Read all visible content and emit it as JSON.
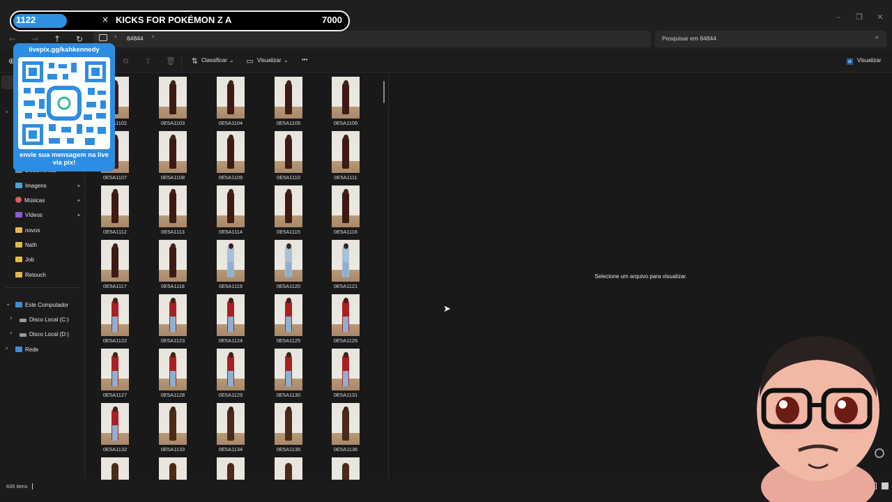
{
  "overlay": {
    "goal_count": "1122",
    "goal_title": "KICKS FOR POKÉMON Z A",
    "goal_target": "7000",
    "goal_progress": 0.16,
    "qr_url": "livepix.gg/kahkennedy",
    "qr_caption": "envie sua mensagem na live via pix!"
  },
  "address": {
    "path_segment": "84844",
    "search_placeholder": "Pesquisar em 84844"
  },
  "toolbar": {
    "sort_label": "Classificar",
    "view_label": "Visualizar",
    "more_label": "•••",
    "preview_label": "Visualizar"
  },
  "sidebar": {
    "pinned": [
      {
        "label": "Documentos",
        "icon": "document-icon"
      },
      {
        "label": "Imagens",
        "icon": "image-icon"
      },
      {
        "label": "Músicas",
        "icon": "music-icon"
      },
      {
        "label": "Vídeos",
        "icon": "video-icon"
      }
    ],
    "folders": [
      "novos",
      "Nath",
      "Job",
      "Retouch"
    ],
    "this_pc": "Este Computador",
    "drives": [
      "Disco Local (C:)",
      "Disco Local (D:)"
    ],
    "network": "Rede"
  },
  "files": [
    "0E5A1102",
    "0E5A1103",
    "0E5A1104",
    "0E5A1105",
    "0E5A1106",
    "0E5A1107",
    "0E5A1108",
    "0E5A1109",
    "0E5A1110",
    "0E5A1111",
    "0E5A1112",
    "0E5A1113",
    "0E5A1114",
    "0E5A1115",
    "0E5A1116",
    "0E5A1117",
    "0E5A1118",
    "0E5A1119",
    "0E5A1120",
    "0E5A1121",
    "0E5A1122",
    "0E5A1123",
    "0E5A1124",
    "0E5A1125",
    "0E5A1126",
    "0E5A1127",
    "0E5A1128",
    "0E5A1129",
    "0E5A1130",
    "0E5A1131",
    "0E5A1132",
    "0E5A1133",
    "0E5A1134",
    "0E5A1135",
    "0E5A1136"
  ],
  "preview": {
    "message": "Selecione um arquivo para visualizar."
  },
  "status": {
    "item_count": "635 itens"
  },
  "colors": {
    "accent": "#2f8fe0",
    "folder": "#e8b84a",
    "background": "#191919"
  }
}
